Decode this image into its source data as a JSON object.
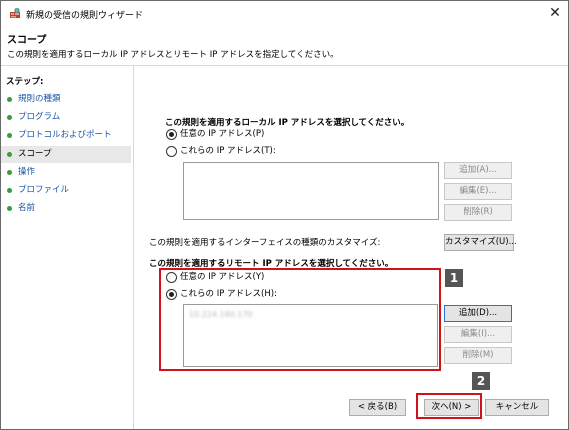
{
  "window": {
    "title": "新規の受信の規則ウィザード",
    "close_glyph": "✕"
  },
  "header": {
    "title": "スコープ",
    "description": "この規則を適用するローカル IP アドレスとリモート IP アドレスを指定してください。"
  },
  "sidebar": {
    "steps_label": "ステップ:",
    "items": [
      {
        "label": "規則の種類",
        "active": false
      },
      {
        "label": "プログラム",
        "active": false
      },
      {
        "label": "プロトコルおよびポート",
        "active": false
      },
      {
        "label": "スコープ",
        "active": true
      },
      {
        "label": "操作",
        "active": false
      },
      {
        "label": "プロファイル",
        "active": false
      },
      {
        "label": "名前",
        "active": false
      }
    ]
  },
  "local": {
    "heading": "この規則を適用するローカル IP アドレスを選択してください。",
    "option_any": "任意の IP アドレス(P)",
    "option_these": "これらの IP アドレス(T):",
    "selected": "any",
    "buttons": {
      "add": "追加(A)...",
      "edit": "編集(E)...",
      "remove": "削除(R)"
    }
  },
  "interface": {
    "label": "この規則を適用するインターフェイスの種類のカスタマイズ:",
    "customize_button": "カスタマイズ(U)..."
  },
  "remote": {
    "heading": "この規則を適用するリモート IP アドレスを選択してください。",
    "option_any": "任意の IP アドレス(Y)",
    "option_these": "これらの IP アドレス(H):",
    "selected": "these",
    "address_entry": "10.224.180.170",
    "buttons": {
      "add": "追加(D)...",
      "edit": "編集(I)...",
      "remove": "削除(M)"
    }
  },
  "footer": {
    "back": "< 戻る(B)",
    "next": "次へ(N) >",
    "cancel": "キャンセル"
  },
  "annotations": {
    "badge1": "1",
    "badge2": "2",
    "highlight_color": "#d0121b"
  }
}
